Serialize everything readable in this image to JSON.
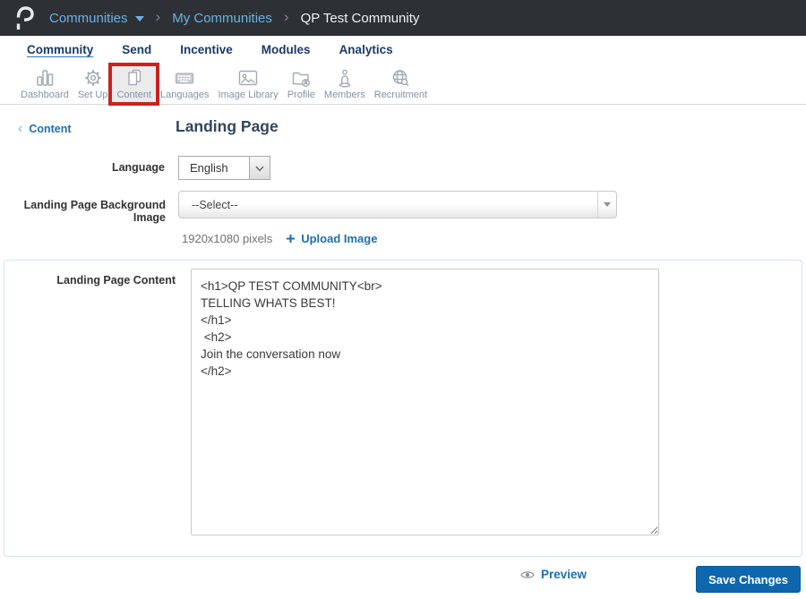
{
  "topbar": {
    "menu_label": "Communities",
    "separator": "›",
    "breadcrumb": [
      "My Communities",
      "QP Test Community"
    ]
  },
  "nav": {
    "tabs": [
      {
        "label": "Community",
        "active": true
      },
      {
        "label": "Send"
      },
      {
        "label": "Incentive"
      },
      {
        "label": "Modules"
      },
      {
        "label": "Analytics"
      }
    ]
  },
  "toolbar": {
    "items": [
      {
        "label": "Dashboard",
        "icon": "bar-chart-icon"
      },
      {
        "label": "Set Up",
        "icon": "gear-icon"
      },
      {
        "label": "Content",
        "icon": "documents-icon",
        "highlighted": true
      },
      {
        "label": "Languages",
        "icon": "keyboard-icon"
      },
      {
        "label": "Image Library",
        "icon": "picture-icon"
      },
      {
        "label": "Profile",
        "icon": "folder-person-icon"
      },
      {
        "label": "Members",
        "icon": "person-icon"
      },
      {
        "label": "Recruitment",
        "icon": "globe-search-icon"
      }
    ]
  },
  "page": {
    "back_chevron": "‹",
    "back_label": "Content",
    "title": "Landing Page"
  },
  "form": {
    "language": {
      "label": "Language",
      "value": "English"
    },
    "background_image": {
      "label": "Landing Page Background Image",
      "value": "--Select--",
      "size_hint": "1920x1080 pixels",
      "upload_label": "Upload Image"
    },
    "content": {
      "label": "Landing Page Content",
      "value": "<h1>QP TEST COMMUNITY<br>\nTELLING WHATS BEST!\n</h1>\n <h2>\nJoin the conversation now\n</h2>"
    }
  },
  "footer": {
    "preview_label": "Preview",
    "save_label": "Save Changes"
  },
  "icons": {
    "logo": "stylized-P-hook",
    "menu_caret": "triangle-down",
    "language_arrow": "chevron-down",
    "bg_select_arrow": "triangle-down",
    "upload": "plus",
    "preview": "eye"
  },
  "colors": {
    "topbar_bg": "#2d3136",
    "breadcrumb_link": "#6cb2e2",
    "nav_text": "#1b3a66",
    "link_blue": "#1e6fae",
    "annotation_red": "#c8231f",
    "save_button": "#0e67ad",
    "panel_border": "#cfe4ef",
    "icon_gray": "#a3abb5"
  }
}
